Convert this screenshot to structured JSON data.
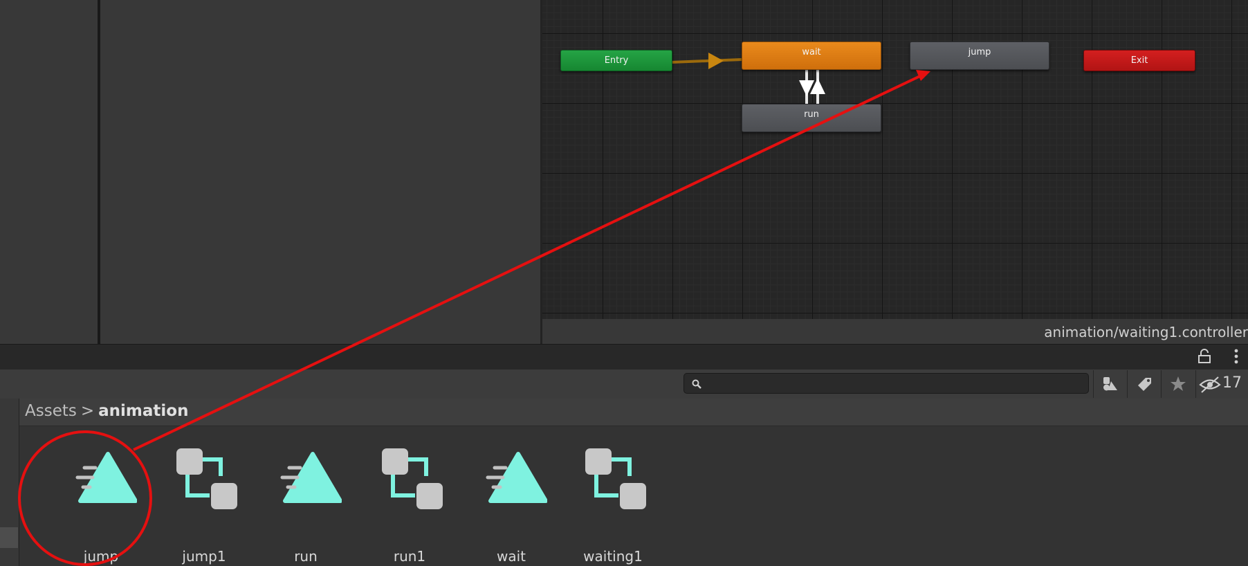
{
  "graph": {
    "nodes": {
      "entry": "Entry",
      "wait": "wait",
      "jump": "jump",
      "run": "run",
      "exit": "Exit"
    },
    "path": "animation/waiting1.controller"
  },
  "toolbar": {
    "search_placeholder": "",
    "hidden_count": "17"
  },
  "breadcrumb": {
    "root": "Assets",
    "separator": ">",
    "current": "animation"
  },
  "assets": [
    {
      "name": "jump",
      "icon": "animation-clip-icon"
    },
    {
      "name": "jump1",
      "icon": "animator-controller-icon"
    },
    {
      "name": "run",
      "icon": "animation-clip-icon"
    },
    {
      "name": "run1",
      "icon": "animator-controller-icon"
    },
    {
      "name": "wait",
      "icon": "animation-clip-icon"
    },
    {
      "name": "waiting1",
      "icon": "animator-controller-icon"
    }
  ],
  "colors": {
    "entry": "#1f9a3d",
    "wait": "#e07e14",
    "state": "#55575b",
    "exit": "#c41919",
    "asset_accent": "#7ff2e0",
    "annotation": "#e51010"
  }
}
